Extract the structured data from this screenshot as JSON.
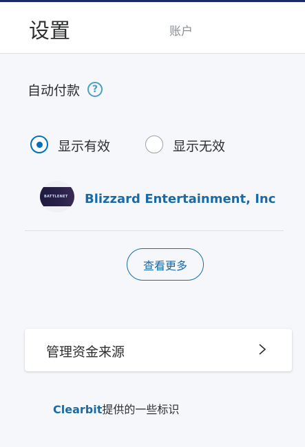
{
  "header": {
    "title": "设置",
    "account_tab": "账户"
  },
  "autopay": {
    "title": "自动付款",
    "help_icon": "question-circle-icon",
    "options": [
      {
        "label": "显示有效",
        "selected": true
      },
      {
        "label": "显示无效",
        "selected": false
      }
    ],
    "merchant": {
      "name": "Blizzard Entertainment, Inc",
      "logo_text": "BATTLENET"
    },
    "more_label": "查看更多"
  },
  "manage": {
    "label": "管理资金来源",
    "icon": "chevron-right-icon"
  },
  "footer": {
    "brand": "Clearbit",
    "text": "提供的一些标识"
  },
  "colors": {
    "accent": "#0070ba",
    "link": "#1a6aa5",
    "top_border": "#1b2a6b",
    "background": "#f5f7fa"
  }
}
